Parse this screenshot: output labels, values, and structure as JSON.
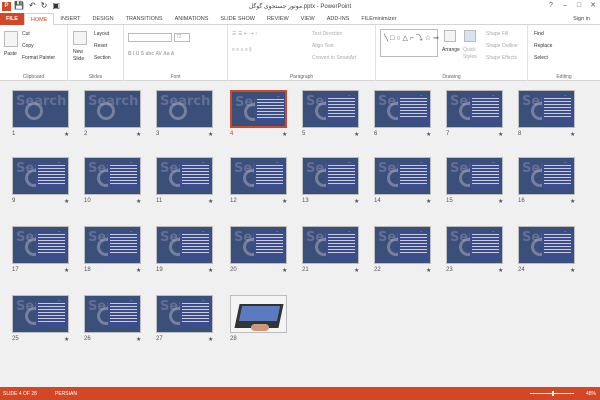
{
  "app": {
    "window_title": "موتور جستجوی گوگل.pptx - PowerPoint",
    "sign_in": "Sign in",
    "window_controls": [
      "?",
      "–",
      "□",
      "✕"
    ],
    "file_icon_letter": "P",
    "qat_icons": [
      "save-icon",
      "undo-icon",
      "redo-icon",
      "start-slideshow-icon"
    ]
  },
  "tabs": [
    "FILE",
    "HOME",
    "INSERT",
    "DESIGN",
    "TRANSITIONS",
    "ANIMATIONS",
    "SLIDE SHOW",
    "REVIEW",
    "VIEW",
    "ADD-INS",
    "FILEminimizer"
  ],
  "active_tab": "HOME",
  "ribbon": {
    "clipboard": {
      "label": "Clipboard",
      "paste": "Paste",
      "cut": "Cut",
      "copy": "Copy",
      "format_painter": "Format Painter"
    },
    "slides": {
      "label": "Slides",
      "new_slide": "New",
      "new_slide_2": "Slide",
      "layout": "Layout",
      "reset": "Reset",
      "section": "Section"
    },
    "font": {
      "label": "Font",
      "size": "72"
    },
    "paragraph": {
      "label": "Paragraph",
      "text_direction": "Text Direction",
      "align_text": "Align Text",
      "convert_smartart": "Convert to SmartArt"
    },
    "drawing": {
      "label": "Drawing",
      "arrange": "Arrange",
      "quick_styles": "Quick",
      "quick_styles_2": "Styles",
      "shape_fill": "Shape Fill",
      "shape_outline": "Shape Outline",
      "shape_effects": "Shape Effects"
    },
    "editing": {
      "label": "Editing",
      "find": "Find",
      "replace": "Replace",
      "select": "Select"
    }
  },
  "slides": {
    "count": 28,
    "selected": 4,
    "numbers": [
      "1",
      "2",
      "3",
      "4",
      "5",
      "6",
      "7",
      "8",
      "9",
      "10",
      "11",
      "12",
      "13",
      "14",
      "15",
      "16",
      "17",
      "18",
      "19",
      "20",
      "21",
      "22",
      "23",
      "24",
      "25",
      "26",
      "27",
      "28"
    ],
    "search_word": "Search"
  },
  "status": {
    "slide_info": "SLIDE 4 OF 28",
    "language": "PERSIAN",
    "zoom": "48%"
  }
}
